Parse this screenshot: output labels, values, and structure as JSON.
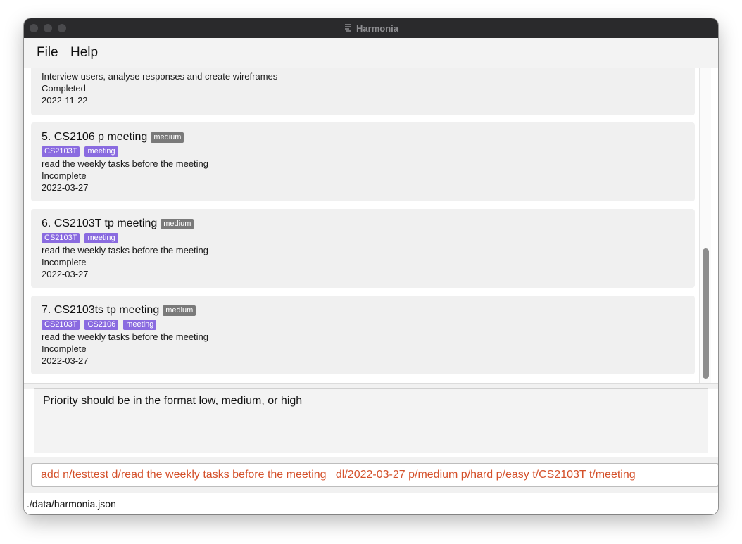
{
  "window": {
    "title": "Harmonia"
  },
  "menu": {
    "file": "File",
    "help": "Help"
  },
  "tasks": [
    {
      "description": "Interview users, analyse responses and create wireframes",
      "status": "Completed",
      "deadline": "2022-11-22"
    },
    {
      "title": "5. CS2106 p meeting",
      "priority": "medium",
      "tags": [
        "CS2103T",
        "meeting"
      ],
      "description": "read the weekly tasks before the meeting",
      "status": "Incomplete",
      "deadline": "2022-03-27"
    },
    {
      "title": "6. CS2103T tp meeting",
      "priority": "medium",
      "tags": [
        "CS2103T",
        "meeting"
      ],
      "description": "read the weekly tasks before the meeting",
      "status": "Incomplete",
      "deadline": "2022-03-27"
    },
    {
      "title": "7. CS2103ts tp meeting",
      "priority": "medium",
      "tags": [
        "CS2103T",
        "CS2106",
        "meeting"
      ],
      "description": "read the weekly tasks before the meeting",
      "status": "Incomplete",
      "deadline": "2022-03-27"
    }
  ],
  "result": {
    "message": "Priority should be in the format low, medium, or high"
  },
  "command": {
    "value": "add n/testtest d/read the weekly tasks before the meeting   dl/2022-03-27 p/medium p/hard p/easy t/CS2103T t/meeting"
  },
  "status_bar": {
    "path": "./data/harmonia.json"
  },
  "colors": {
    "tag": "#8a6be0",
    "priority_badge": "#7a7a7a",
    "command_text": "#d4502a",
    "titlebar": "#2a2a2c"
  },
  "icons": {
    "app": "harmonia-app-icon"
  }
}
